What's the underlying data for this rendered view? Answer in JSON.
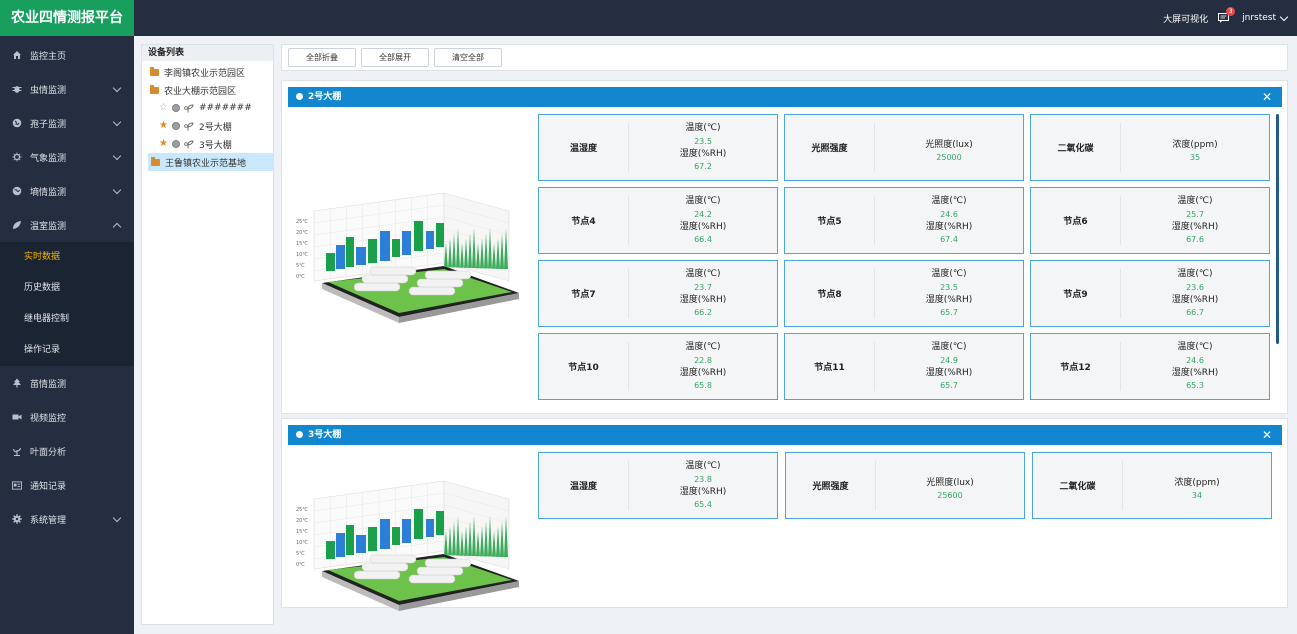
{
  "app": {
    "title": "农业四情测报平台"
  },
  "header": {
    "bigscreen": "大屏可视化",
    "badge_count": "3",
    "user": "jnrstest"
  },
  "sidebar": {
    "items": [
      {
        "label": "监控主页",
        "icon": "home-icon"
      },
      {
        "label": "虫情监测",
        "icon": "bug-icon"
      },
      {
        "label": "孢子监测",
        "icon": "globe-icon"
      },
      {
        "label": "气象监测",
        "icon": "weather-icon"
      },
      {
        "label": "墒情监测",
        "icon": "soil-icon"
      },
      {
        "label": "温室监测",
        "icon": "leaf-icon"
      },
      {
        "label": "苗情监测",
        "icon": "tree-icon"
      },
      {
        "label": "视频监控",
        "icon": "video-icon"
      },
      {
        "label": "叶面分析",
        "icon": "plant-icon"
      },
      {
        "label": "通知记录",
        "icon": "card-icon"
      },
      {
        "label": "系统管理",
        "icon": "gear-icon"
      }
    ],
    "sub_items": [
      "实时数据",
      "历史数据",
      "继电器控制",
      "操作记录"
    ]
  },
  "tree": {
    "title": "设备列表",
    "nodes": [
      "李阁镇农业示范园区",
      "农业大棚示范园区",
      "#######",
      "2号大棚",
      "3号大棚",
      "王鲁镇农业示范基地"
    ]
  },
  "toolbar": {
    "collapse_all": "全部折叠",
    "expand_all": "全部展开",
    "clear_all": "清空全部"
  },
  "panels": [
    {
      "title": "2号大棚",
      "cards": [
        {
          "label": "温湿度",
          "lines": [
            "温度(℃)",
            "23.5",
            "湿度(%RH)",
            "67.2"
          ]
        },
        {
          "label": "光照强度",
          "lines": [
            "光照度(lux)",
            "25000"
          ]
        },
        {
          "label": "二氧化碳",
          "lines": [
            "浓度(ppm)",
            "35"
          ]
        },
        {
          "label": "节点4",
          "lines": [
            "温度(℃)",
            "24.2",
            "湿度(%RH)",
            "66.4"
          ]
        },
        {
          "label": "节点5",
          "lines": [
            "温度(℃)",
            "24.6",
            "湿度(%RH)",
            "67.4"
          ]
        },
        {
          "label": "节点6",
          "lines": [
            "温度(℃)",
            "25.7",
            "湿度(%RH)",
            "67.6"
          ]
        },
        {
          "label": "节点7",
          "lines": [
            "温度(℃)",
            "23.7",
            "湿度(%RH)",
            "66.2"
          ]
        },
        {
          "label": "节点8",
          "lines": [
            "温度(℃)",
            "23.5",
            "湿度(%RH)",
            "65.7"
          ]
        },
        {
          "label": "节点9",
          "lines": [
            "温度(℃)",
            "23.6",
            "湿度(%RH)",
            "66.7"
          ]
        },
        {
          "label": "节点10",
          "lines": [
            "温度(℃)",
            "22.8",
            "湿度(%RH)",
            "65.8"
          ]
        },
        {
          "label": "节点11",
          "lines": [
            "温度(℃)",
            "24.9",
            "湿度(%RH)",
            "65.7"
          ]
        },
        {
          "label": "节点12",
          "lines": [
            "温度(℃)",
            "24.6",
            "湿度(%RH)",
            "65.3"
          ]
        }
      ]
    },
    {
      "title": "3号大棚",
      "cards": [
        {
          "label": "温湿度",
          "lines": [
            "温度(℃)",
            "23.8",
            "湿度(%RH)",
            "65.4"
          ]
        },
        {
          "label": "光照强度",
          "lines": [
            "光照度(lux)",
            "25600"
          ]
        },
        {
          "label": "二氧化碳",
          "lines": [
            "浓度(ppm)",
            "34"
          ]
        }
      ]
    }
  ],
  "scene_axis": [
    "25℃",
    "20℃",
    "15℃",
    "10℃",
    "5℃",
    "0℃"
  ],
  "colors": {
    "brand": "#189f5e",
    "nav": "#242e40",
    "panel_header": "#1287cf",
    "value": "#33a765",
    "active_sub": "#f4b400"
  }
}
